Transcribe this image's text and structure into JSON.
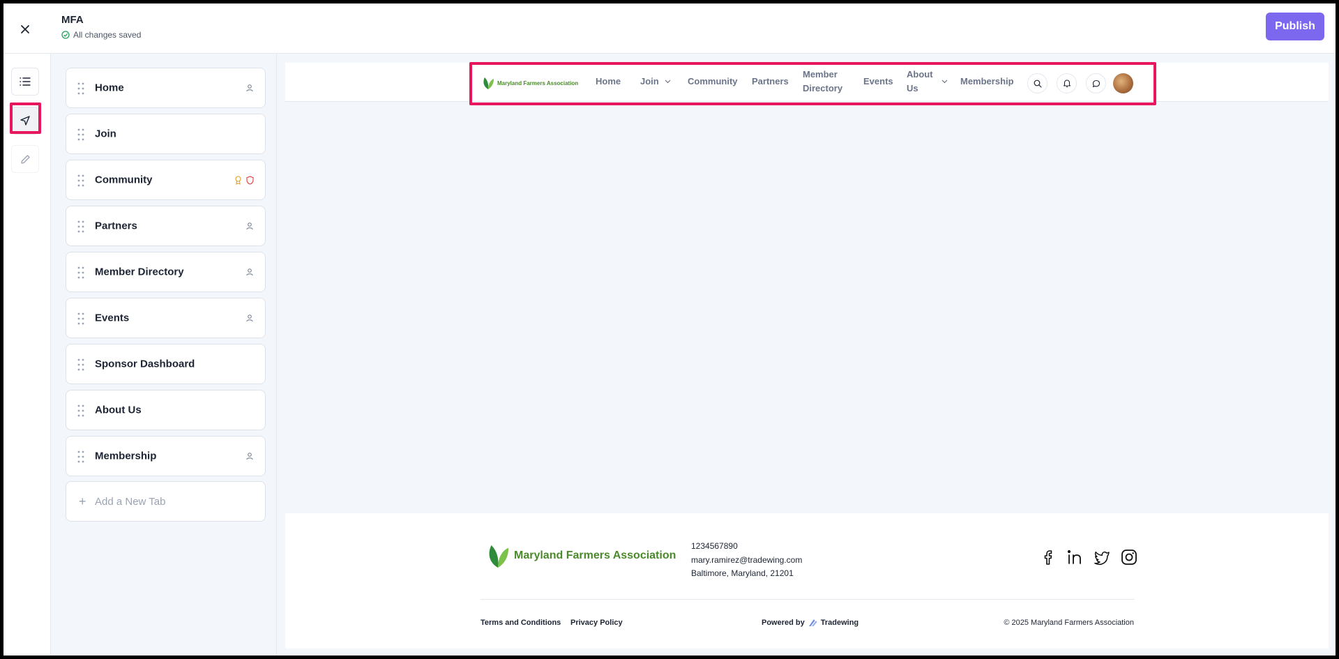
{
  "editor": {
    "site_name": "MFA",
    "save_status": "All changes saved",
    "publish_label": "Publish"
  },
  "tabs": [
    {
      "label": "Home",
      "icons": [
        "user-icon"
      ]
    },
    {
      "label": "Join",
      "icons": []
    },
    {
      "label": "Community",
      "icons": [
        "award-icon",
        "shield-icon"
      ]
    },
    {
      "label": "Partners",
      "icons": [
        "user-icon"
      ]
    },
    {
      "label": "Member Directory",
      "icons": [
        "user-icon"
      ]
    },
    {
      "label": "Events",
      "icons": [
        "user-icon"
      ]
    },
    {
      "label": "Sponsor Dashboard",
      "icons": []
    },
    {
      "label": "About Us",
      "icons": []
    },
    {
      "label": "Membership",
      "icons": [
        "user-icon"
      ]
    }
  ],
  "add_tab_label": "Add a New Tab",
  "site": {
    "logo_text": "Maryland Farmers Association",
    "nav": {
      "home": "Home",
      "join": "Join",
      "community": "Community",
      "partners": "Partners",
      "member_directory_1": "Member",
      "member_directory_2": "Directory",
      "events": "Events",
      "about_us_1": "About",
      "about_us_2": "Us",
      "membership": "Membership"
    },
    "footer": {
      "logo_text": "Maryland Farmers Association",
      "phone": "1234567890",
      "email": "mary.ramirez@tradewing.com",
      "address": "Baltimore, Maryland, 21201",
      "terms": "Terms and Conditions",
      "privacy": "Privacy Policy",
      "powered_by": "Powered by",
      "powered_brand": "Tradewing",
      "copyright": "© 2025 Maryland Farmers Association"
    }
  },
  "colors": {
    "accent": "#7b68ee",
    "highlight": "#e8175d",
    "brand_green": "#4a8a2a"
  }
}
